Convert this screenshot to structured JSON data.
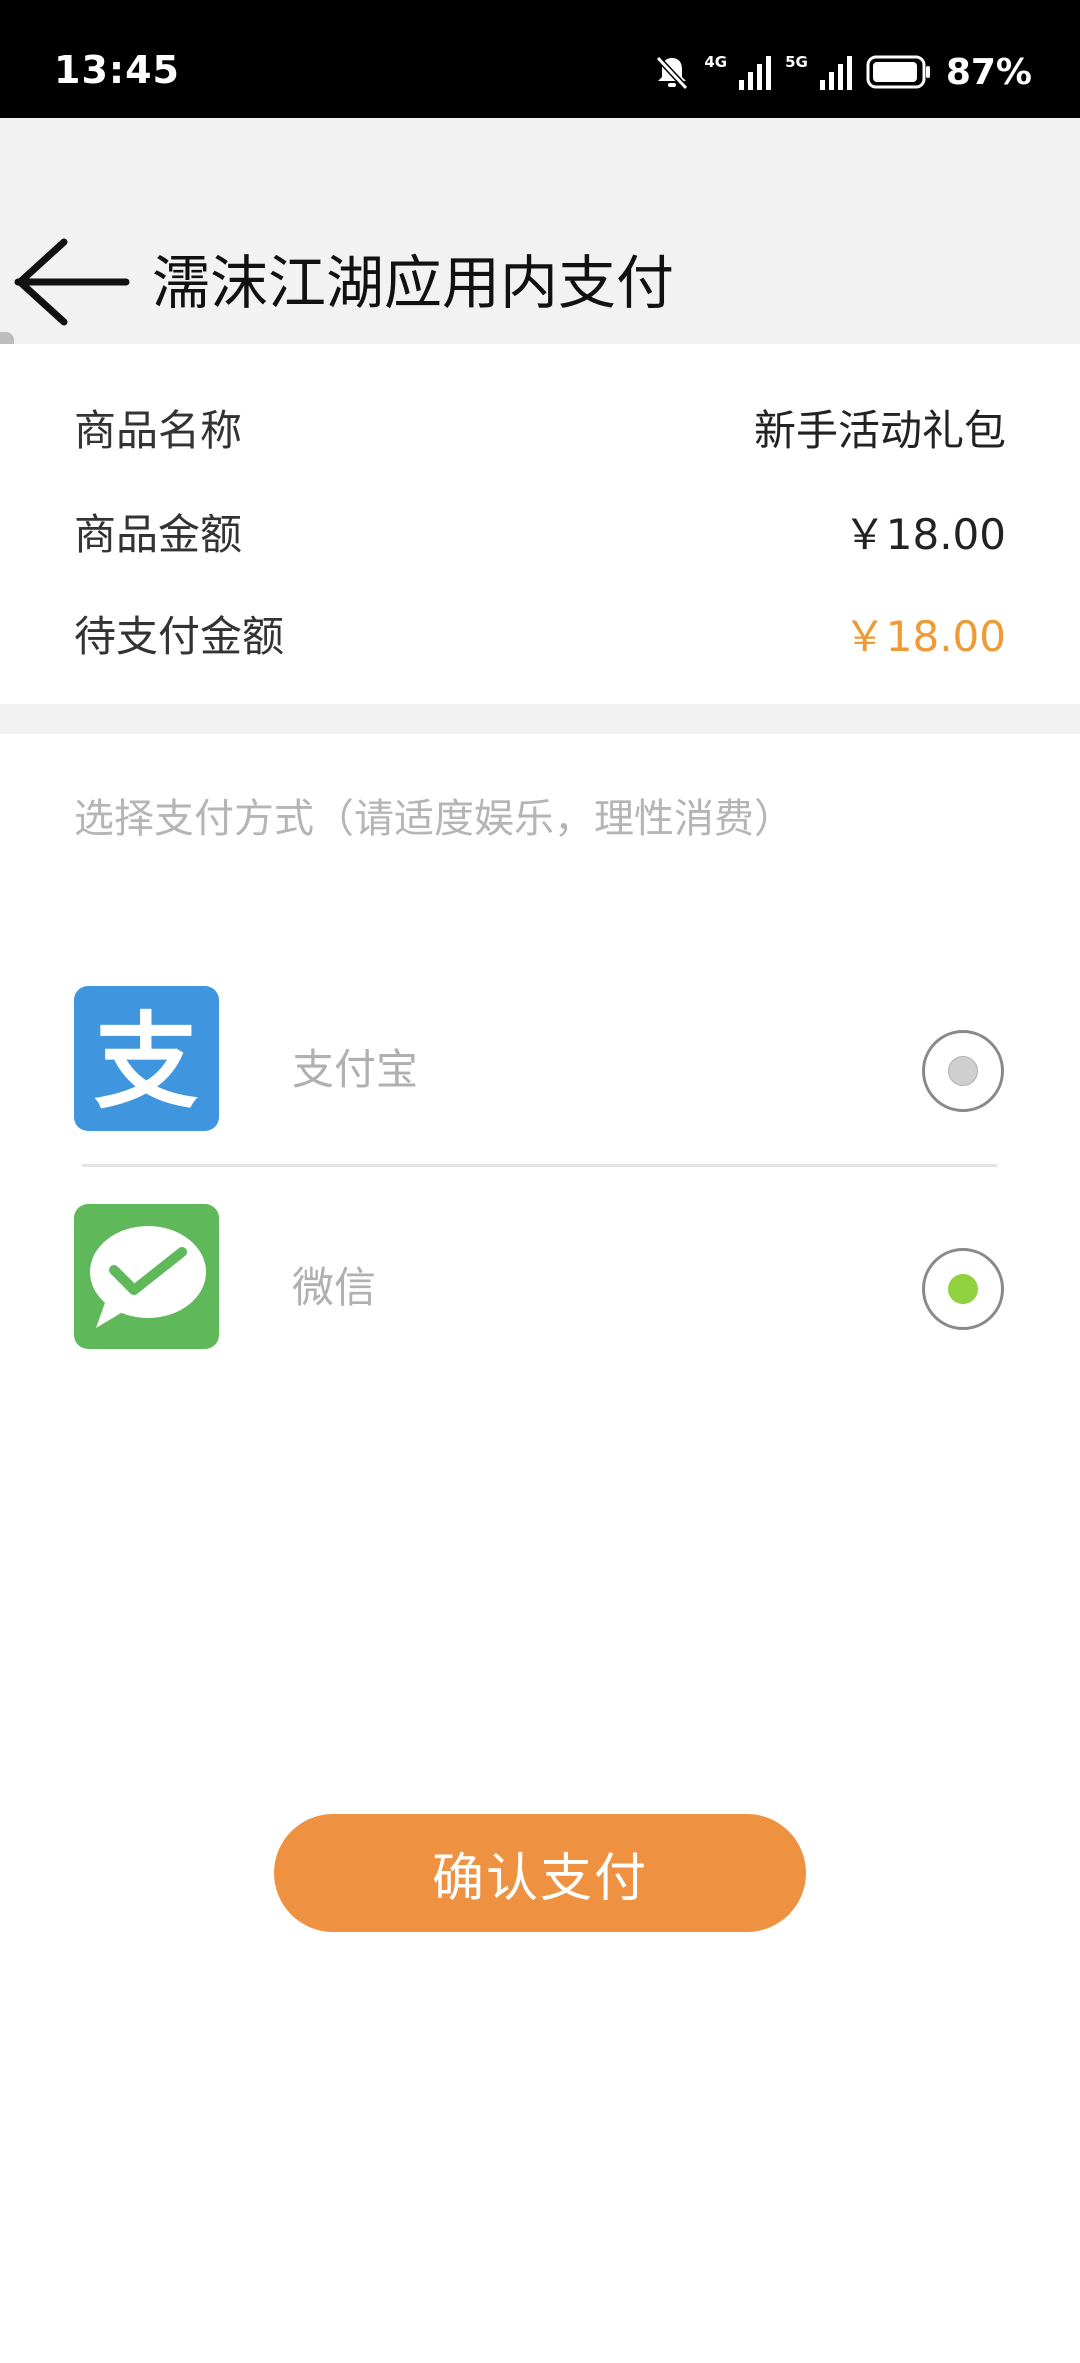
{
  "status_bar": {
    "time": "13:45",
    "network_1": "4G",
    "network_2": "5G",
    "battery_percent": "87%",
    "icons": [
      "bell-muted-icon",
      "signal-4g-icon",
      "signal-5g-icon",
      "battery-icon"
    ]
  },
  "header": {
    "title": "濡沫江湖应用内支付",
    "back_icon": "arrow-left-icon"
  },
  "order": {
    "rows": [
      {
        "label": "商品名称",
        "value": "新手活动礼包"
      },
      {
        "label": "商品金额",
        "value": "￥18.00"
      },
      {
        "label": "待支付金额",
        "value": "￥18.00"
      }
    ],
    "accent_color": "#ee9a35"
  },
  "payment": {
    "hint": "选择支付方式（请适度娱乐，理性消费）",
    "methods": [
      {
        "label": "支付宝",
        "logo_glyph": "支",
        "icon": "alipay-icon",
        "brand_color": "#3f95de",
        "selected": false
      },
      {
        "label": "微信",
        "icon": "wechat-icon",
        "brand_color": "#5fb85a",
        "selected": true
      }
    ],
    "selected_dot_color": "#8fd13f"
  },
  "confirm": {
    "label": "确认支付",
    "color": "#ee9140"
  }
}
